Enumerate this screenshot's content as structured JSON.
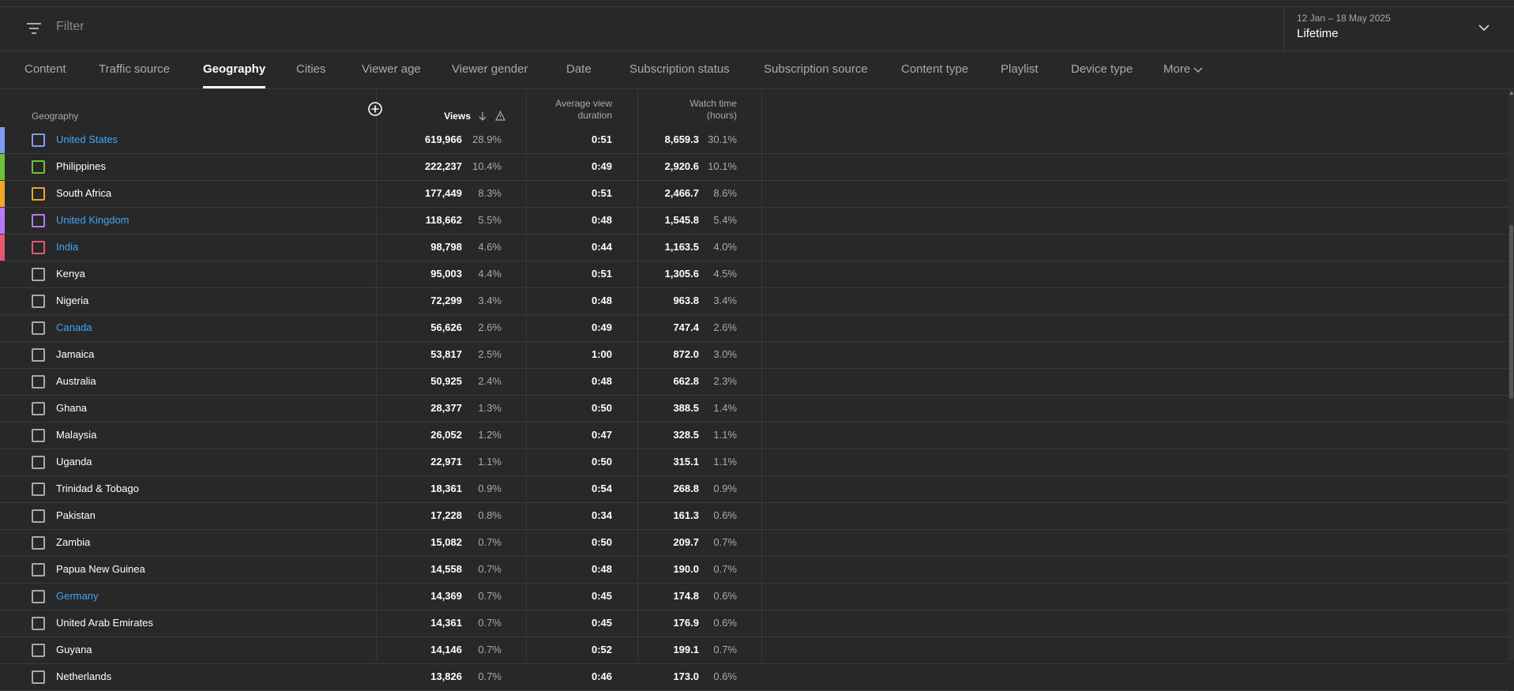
{
  "filter": {
    "placeholder": "Filter"
  },
  "date": {
    "range": "12 Jan – 18 May 2025",
    "period": "Lifetime"
  },
  "tabs": [
    "Content",
    "Traffic source",
    "Geography",
    "Cities",
    "Viewer age",
    "Viewer gender",
    "Date",
    "Subscription status",
    "Subscription source",
    "Content type",
    "Playlist",
    "Device type",
    "More"
  ],
  "active_tab": "Geography",
  "columns": {
    "geography": "Geography",
    "views": "Views",
    "avg_duration_1": "Average view",
    "avg_duration_2": "duration",
    "watch_time_1": "Watch time",
    "watch_time_2": "(hours)"
  },
  "rows": [
    {
      "name": "United States",
      "views": "619,966",
      "views_pct": "28.9%",
      "duration": "0:51",
      "watch": "8,659.3",
      "watch_pct": "30.1%",
      "color": "#7f9cf5",
      "link": true
    },
    {
      "name": "Philippines",
      "views": "222,237",
      "views_pct": "10.4%",
      "duration": "0:49",
      "watch": "2,920.6",
      "watch_pct": "10.1%",
      "color": "#6ac239",
      "link": false
    },
    {
      "name": "South Africa",
      "views": "177,449",
      "views_pct": "8.3%",
      "duration": "0:51",
      "watch": "2,466.7",
      "watch_pct": "8.6%",
      "color": "#f5a524",
      "link": false
    },
    {
      "name": "United Kingdom",
      "views": "118,662",
      "views_pct": "5.5%",
      "duration": "0:48",
      "watch": "1,545.8",
      "watch_pct": "5.4%",
      "color": "#b57bf5",
      "link": true
    },
    {
      "name": "India",
      "views": "98,798",
      "views_pct": "4.6%",
      "duration": "0:44",
      "watch": "1,163.5",
      "watch_pct": "4.0%",
      "color": "#e8566f",
      "link": true
    },
    {
      "name": "Kenya",
      "views": "95,003",
      "views_pct": "4.4%",
      "duration": "0:51",
      "watch": "1,305.6",
      "watch_pct": "4.5%",
      "color": "",
      "link": false
    },
    {
      "name": "Nigeria",
      "views": "72,299",
      "views_pct": "3.4%",
      "duration": "0:48",
      "watch": "963.8",
      "watch_pct": "3.4%",
      "color": "",
      "link": false
    },
    {
      "name": "Canada",
      "views": "56,626",
      "views_pct": "2.6%",
      "duration": "0:49",
      "watch": "747.4",
      "watch_pct": "2.6%",
      "color": "",
      "link": true
    },
    {
      "name": "Jamaica",
      "views": "53,817",
      "views_pct": "2.5%",
      "duration": "1:00",
      "watch": "872.0",
      "watch_pct": "3.0%",
      "color": "",
      "link": false
    },
    {
      "name": "Australia",
      "views": "50,925",
      "views_pct": "2.4%",
      "duration": "0:48",
      "watch": "662.8",
      "watch_pct": "2.3%",
      "color": "",
      "link": false
    },
    {
      "name": "Ghana",
      "views": "28,377",
      "views_pct": "1.3%",
      "duration": "0:50",
      "watch": "388.5",
      "watch_pct": "1.4%",
      "color": "",
      "link": false
    },
    {
      "name": "Malaysia",
      "views": "26,052",
      "views_pct": "1.2%",
      "duration": "0:47",
      "watch": "328.5",
      "watch_pct": "1.1%",
      "color": "",
      "link": false
    },
    {
      "name": "Uganda",
      "views": "22,971",
      "views_pct": "1.1%",
      "duration": "0:50",
      "watch": "315.1",
      "watch_pct": "1.1%",
      "color": "",
      "link": false
    },
    {
      "name": "Trinidad & Tobago",
      "views": "18,361",
      "views_pct": "0.9%",
      "duration": "0:54",
      "watch": "268.8",
      "watch_pct": "0.9%",
      "color": "",
      "link": false
    },
    {
      "name": "Pakistan",
      "views": "17,228",
      "views_pct": "0.8%",
      "duration": "0:34",
      "watch": "161.3",
      "watch_pct": "0.6%",
      "color": "",
      "link": false
    },
    {
      "name": "Zambia",
      "views": "15,082",
      "views_pct": "0.7%",
      "duration": "0:50",
      "watch": "209.7",
      "watch_pct": "0.7%",
      "color": "",
      "link": false
    },
    {
      "name": "Papua New Guinea",
      "views": "14,558",
      "views_pct": "0.7%",
      "duration": "0:48",
      "watch": "190.0",
      "watch_pct": "0.7%",
      "color": "",
      "link": false
    },
    {
      "name": "Germany",
      "views": "14,369",
      "views_pct": "0.7%",
      "duration": "0:45",
      "watch": "174.8",
      "watch_pct": "0.6%",
      "color": "",
      "link": true
    },
    {
      "name": "United Arab Emirates",
      "views": "14,361",
      "views_pct": "0.7%",
      "duration": "0:45",
      "watch": "176.9",
      "watch_pct": "0.6%",
      "color": "",
      "link": false
    },
    {
      "name": "Guyana",
      "views": "14,146",
      "views_pct": "0.7%",
      "duration": "0:52",
      "watch": "199.1",
      "watch_pct": "0.7%",
      "color": "",
      "link": false
    },
    {
      "name": "Netherlands",
      "views": "13,826",
      "views_pct": "0.7%",
      "duration": "0:46",
      "watch": "173.0",
      "watch_pct": "0.6%",
      "color": "",
      "link": false
    }
  ]
}
